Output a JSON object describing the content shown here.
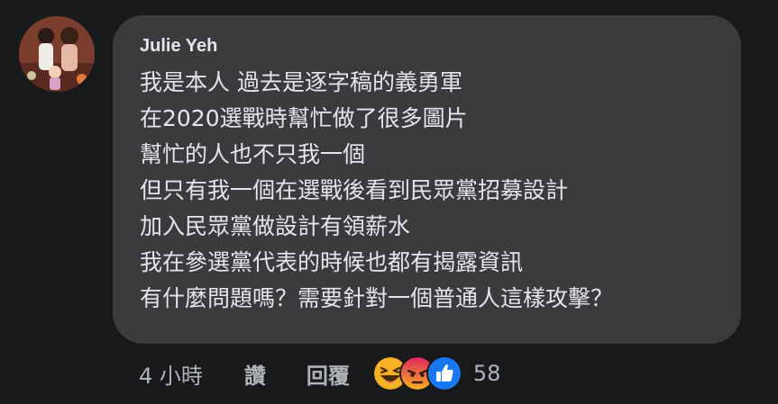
{
  "comment": {
    "author": "Julie Yeh",
    "lines": [
      "我是本人 過去是逐字稿的義勇軍",
      "在2020選戰時幫忙做了很多圖片",
      "幫忙的人也不只我一個",
      "但只有我一個在選戰後看到民眾黨招募設計",
      "加入民眾黨做設計有領薪水",
      "我在參選黨代表的時候也都有揭露資訊",
      "有什麼問題嗎？需要針對一個普通人這樣攻擊？"
    ]
  },
  "footer": {
    "timestamp": "4 小時",
    "like_label": "讚",
    "reply_label": "回覆",
    "reactions": [
      "haha-icon",
      "angry-icon",
      "like-icon"
    ],
    "reaction_count": "58"
  },
  "colors": {
    "background": "#18191a",
    "bubble": "#3a3b3c",
    "text": "#e4e6eb",
    "meta": "#b0b3b8",
    "like_blue": "#1877f2",
    "haha_yellow": "#f7b125",
    "angry_red": "#e9710f"
  }
}
